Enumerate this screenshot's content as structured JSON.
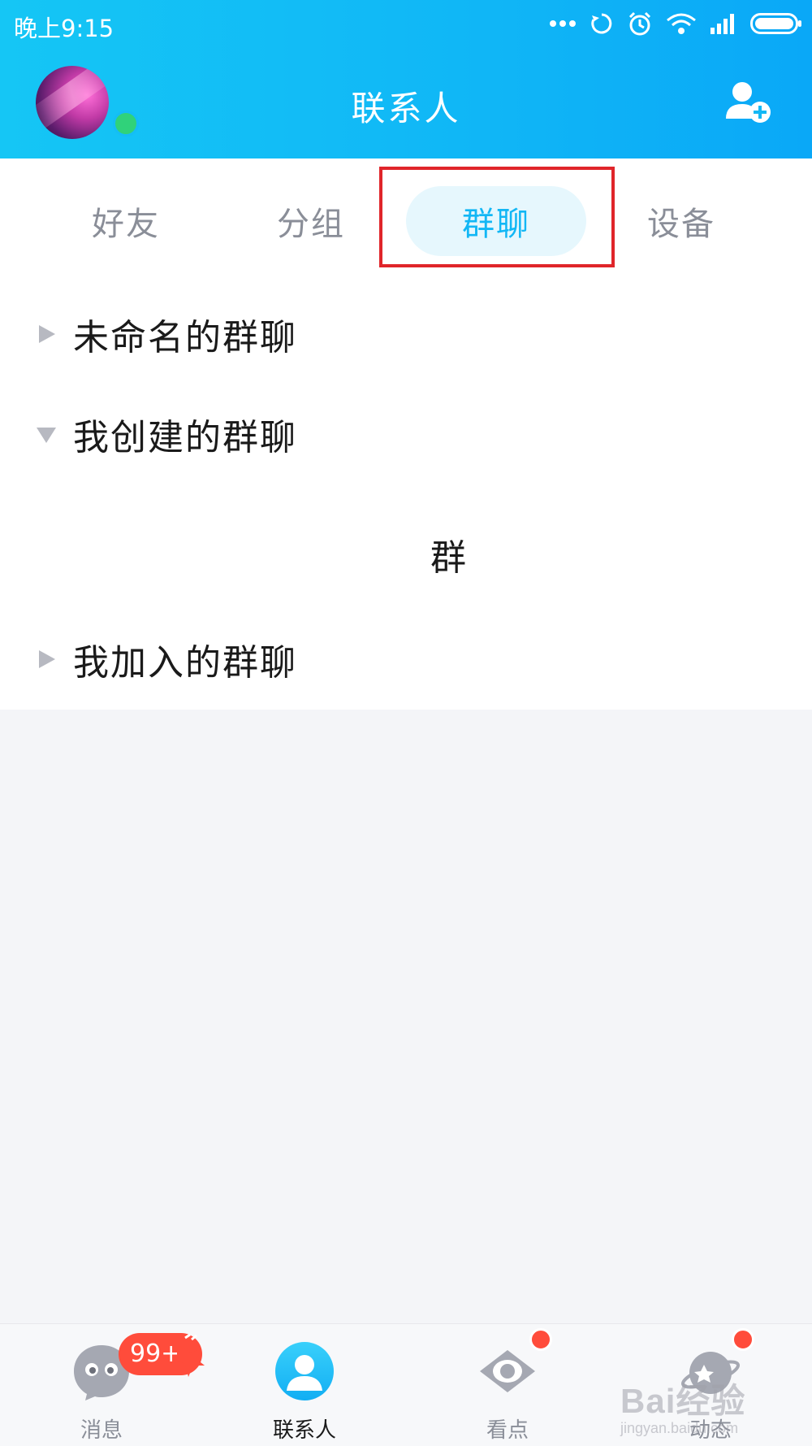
{
  "status_bar": {
    "time": "晚上9:15",
    "icons": [
      "more-dots-icon",
      "sync-icon",
      "alarm-icon",
      "wifi-icon",
      "signal-icon",
      "battery-icon"
    ]
  },
  "header": {
    "title": "联系人",
    "online_status_color": "#30d27a",
    "accent": "#12b7f5"
  },
  "tabs": [
    {
      "label": "好友",
      "active": false
    },
    {
      "label": "分组",
      "active": false
    },
    {
      "label": "群聊",
      "active": true
    },
    {
      "label": "设备",
      "active": false
    }
  ],
  "groups": [
    {
      "label": "未命名的群聊",
      "expanded": false
    },
    {
      "label": "我创建的群聊",
      "expanded": true
    },
    {
      "label": "我加入的群聊",
      "expanded": false
    }
  ],
  "created_group_item": {
    "name": "群"
  },
  "bottom_nav": [
    {
      "label": "消息",
      "icon": "message-icon",
      "active": false
    },
    {
      "label": "联系人",
      "icon": "contacts-icon",
      "active": true
    },
    {
      "label": "看点",
      "icon": "eye-icon",
      "active": false
    },
    {
      "label": "动态",
      "icon": "planet-icon",
      "active": false
    }
  ],
  "message_badge": "99+",
  "watermark": {
    "brand": "Bai经验",
    "url": "jingyan.baidu.com"
  }
}
